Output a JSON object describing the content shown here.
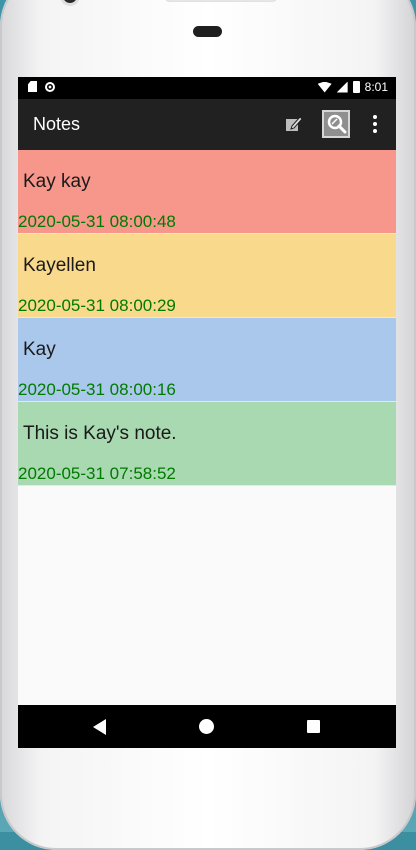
{
  "status_bar": {
    "time": "8:01"
  },
  "toolbar": {
    "title": "Notes",
    "icons": [
      "compose-icon",
      "search-icon",
      "overflow-menu-icon"
    ]
  },
  "notes": [
    {
      "title": "Kay kay",
      "timestamp": "2020-05-31 08:00:48",
      "color": "#f7968a"
    },
    {
      "title": "Kayellen",
      "timestamp": "2020-05-31 08:00:29",
      "color": "#f9d98c"
    },
    {
      "title": "Kay",
      "timestamp": "2020-05-31 08:00:16",
      "color": "#a9c8ec"
    },
    {
      "title": "This is Kay's note.",
      "timestamp": "2020-05-31 07:58:52",
      "color": "#a8d9b0"
    }
  ],
  "colors": {
    "toolbar": "#212121",
    "timestamp": "#007a00",
    "background": "#fafafa"
  },
  "navigation": [
    "back-icon",
    "home-icon",
    "recents-icon"
  ]
}
